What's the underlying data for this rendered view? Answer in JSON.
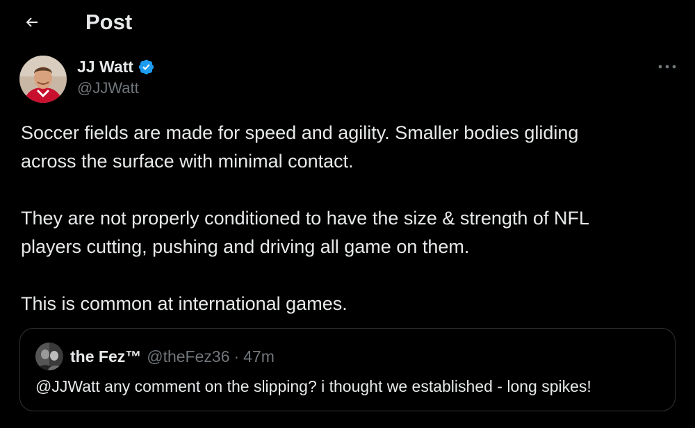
{
  "header": {
    "title": "Post",
    "back_icon": "arrow-left-icon"
  },
  "author": {
    "name": "JJ Watt",
    "handle": "@JJWatt",
    "verified": true,
    "verified_icon": "verified-badge-icon",
    "verified_color": "#1d9bf0"
  },
  "more_icon": "more-horizontal-icon",
  "tweet": {
    "paragraphs": [
      "Soccer fields are made for speed and agility. Smaller bodies gliding\nacross the surface with minimal contact.",
      "They are not properly conditioned to have the size & strength of NFL\nplayers cutting, pushing and driving all game on them.",
      "This is common at international games."
    ]
  },
  "quote": {
    "name": "the Fez™",
    "handle": "@theFez36",
    "separator": "·",
    "time": "47m",
    "text": "@JJWatt any comment on the slipping? i thought we established - long spikes!"
  },
  "colors": {
    "background": "#000000",
    "text_primary": "#e7e9ea",
    "text_secondary": "#71767b",
    "border": "#2f3336",
    "accent": "#1d9bf0"
  }
}
